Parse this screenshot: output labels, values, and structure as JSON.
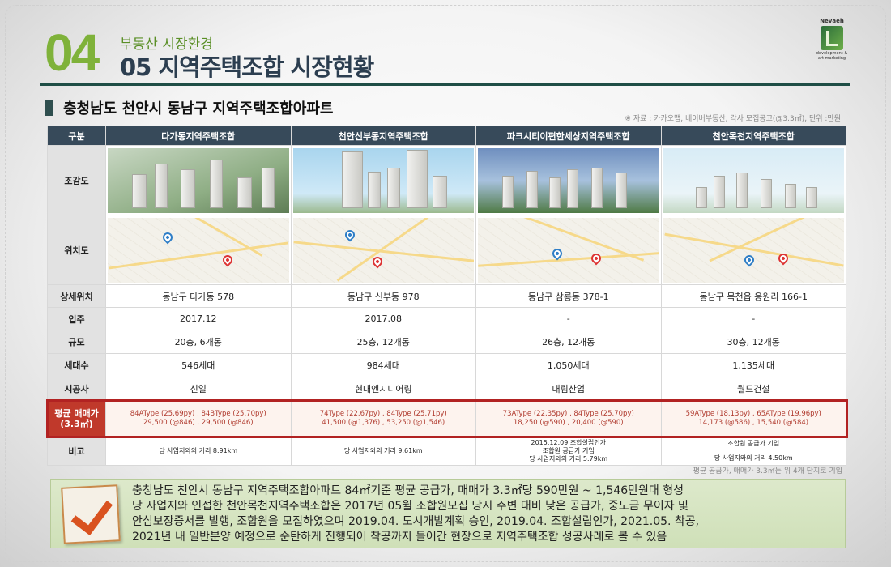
{
  "header": {
    "number": "04",
    "subtitle": "부동산 시장환경",
    "title": "05 지역주택조합 시장현황"
  },
  "logo": {
    "name": "Nevaeh",
    "tagline_1": "development &",
    "tagline_2": "art marketing"
  },
  "section": {
    "title": "충청남도 천안시 동남구 지역주택조합아파트",
    "source": "※ 자료 : 카카오맵, 네이버부동산, 각사 모집공고(@3.3㎡), 단위 :만원"
  },
  "table": {
    "corner": "구분",
    "columns": [
      "다가동지역주택조합",
      "천안신부동지역주택조합",
      "파크시티이편한세상지역주택조합",
      "천안목천지역주택조합"
    ],
    "row_labels": {
      "bird_eye": "조감도",
      "location_map": "위치도",
      "address": "상세위치",
      "move_in": "입주",
      "scale": "규모",
      "households": "세대수",
      "builder": "시공사",
      "price_1": "평균 매매가",
      "price_2": "(3.3㎡)",
      "remarks": "비고"
    },
    "address": [
      "동남구 다가동 578",
      "동남구 신부동 978",
      "동남구 삼룡동 378-1",
      "동남구 목천읍 응원리 166-1"
    ],
    "move_in": [
      "2017.12",
      "2017.08",
      "-",
      "-"
    ],
    "scale": [
      "20층, 6개동",
      "25층, 12개동",
      "26층, 12개동",
      "30층, 12개동"
    ],
    "households": [
      "546세대",
      "984세대",
      "1,050세대",
      "1,135세대"
    ],
    "builder": [
      "신일",
      "현대엔지니어링",
      "대림산업",
      "월드건설"
    ],
    "price": [
      {
        "line1": "84AType (25.69py)   ,   84BType (25.70py)",
        "line2": "29,500 (@846)   ,   29,500 (@846)"
      },
      {
        "line1": "74Type (22.67py)   ,   84Type (25.71py)",
        "line2": "41,500 (@1,376)   ,   53,250 (@1,546)"
      },
      {
        "line1": "73AType (22.35py)   ,   84Type (25.70py)",
        "line2": "18,250 (@590)   ,   20,400 (@590)"
      },
      {
        "line1": "59AType (18.13py)   ,   65AType (19.96py)",
        "line2": "14,173 (@586)   ,   15,540 (@584)"
      }
    ],
    "remarks": [
      {
        "lines": [
          "당 사업지와의 거리 8.91km"
        ]
      },
      {
        "lines": [
          "당 사업지와의 거리 9.61km"
        ]
      },
      {
        "lines": [
          "2015.12.09 조합설립인가",
          "조합원 공급가 기입",
          "당 사업지와의 거리 5.79km"
        ]
      },
      {
        "lines": [
          "조합원 공급가 기입",
          "",
          "당 사업지와의 거리 4.50km"
        ]
      }
    ]
  },
  "footnote": "평균 공급가, 매매가 3.3㎡는 위 4개 단지로 기입",
  "summary": {
    "icon": "checkmark-icon",
    "lines": [
      "충청남도 천안시 동남구 지역주택조합아파트 84㎡기준 평균 공급가, 매매가 3.3㎡당 590만원 ~ 1,546만원대 형성",
      "당 사업지와 인접한 천안목천지역주택조합은 2017년 05월 조합원모집 당시 주변 대비 낮은 공급가, 중도금 무이자 및",
      "안심보장증서를 발행, 조합원을 모집하였으며 2019.04. 도시개발계획 승인, 2019.04. 조합설립인가, 2021.05. 착공,",
      "2021년 내 일반분양 예정으로 순탄하게 진행되어 착공까지 들어간 현장으로 지역주택조합 성공사례로 볼 수 있음"
    ]
  }
}
